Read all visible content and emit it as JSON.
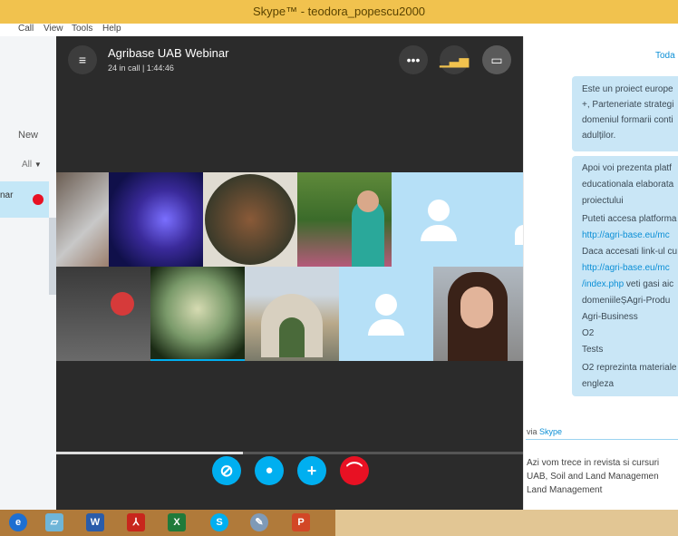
{
  "window": {
    "title": "Skype™ - teodora_popescu2000"
  },
  "menu": [
    "Call",
    "View",
    "Tools",
    "Help"
  ],
  "sidebar": {
    "new_label": "New",
    "filter_label": "All",
    "active_item_partial": "nar"
  },
  "call": {
    "title": "Agribase UAB Webinar",
    "subtitle": "24 in call | 1:44:46",
    "progress_fraction": 0.4
  },
  "chat": {
    "date_header": "Toda",
    "bubble1": [
      "Este un proiect europe",
      "+, Parteneriate strategi",
      "domeniul formarii conti",
      "adulților."
    ],
    "bubble2": {
      "lines": [
        "Apoi voi prezenta platf",
        "educationala elaborata",
        "proiectului",
        "Puteti accesa platforma"
      ],
      "link1": "http://agri-base.eu/mc",
      "line5": "Daca accesati link-ul cu",
      "link2": "http://agri-base.eu/mc",
      "link3": "/index.php",
      "line7_rest": " veti gasi aic",
      "lines_after": [
        "domeniileȘAgri-Produ",
        "Agri-Business",
        "O2",
        "Tests",
        "O2 reprezinta materiale",
        "engleza"
      ]
    },
    "via_label": "via",
    "via_link": "Skype",
    "message": [
      "Azi vom trece in revista si cursuri",
      "UAB, Soil and Land Managemen",
      "Land Management"
    ]
  },
  "colors": {
    "accent": "#00aff0",
    "end_call": "#e81123",
    "titlebar": "#f1c24e"
  },
  "taskbar_icons": [
    "ie-icon",
    "notebook-icon",
    "word-icon",
    "acrobat-icon",
    "excel-icon",
    "skype-icon",
    "paint-icon",
    "powerpoint-icon"
  ],
  "taskbar_labels": {
    "word": "W",
    "excel": "X",
    "skype": "S",
    "powerpoint": "P"
  }
}
